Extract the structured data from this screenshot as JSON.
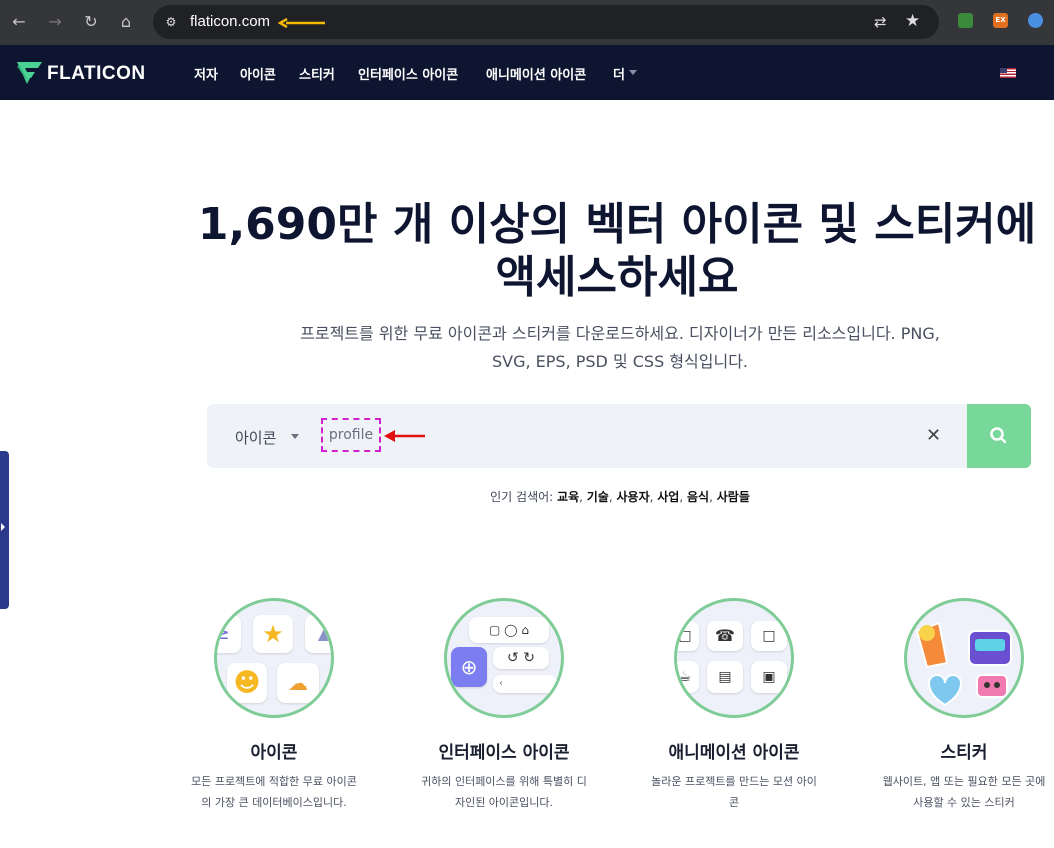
{
  "browser": {
    "url": "flaticon.com",
    "ext1": "",
    "ext2": "EX"
  },
  "header": {
    "logo": "FLATICON",
    "nav": [
      "저자",
      "아이콘",
      "스티커",
      "인터페이스 아이콘",
      "애니메이션 아이콘",
      "더"
    ]
  },
  "hero": {
    "title_line1": "1,690만 개 이상의 벡터 아이콘 및 스티커에",
    "title_line2": "액세스하세요",
    "subtitle_line1": "프로젝트를 위한 무료 아이콘과 스티커를 다운로드하세요. 디자이너가 만든 리소스입니다. PNG,",
    "subtitle_line2": "SVG, EPS, PSD 및 CSS 형식입니다."
  },
  "search": {
    "type": "아이콘",
    "query": "profile"
  },
  "popular": {
    "label": "인기 검색어:",
    "terms": [
      "교육",
      "기술",
      "사용자",
      "사업",
      "음식",
      "사람들"
    ]
  },
  "cards": [
    {
      "title": "아이콘",
      "desc_line1": "모든 프로젝트에 적합한 무료 아이콘",
      "desc_line2": "의 가장 큰 데이터베이스입니다."
    },
    {
      "title": "인터페이스 아이콘",
      "desc_line1": "귀하의 인터페이스를 위해 특별히 디",
      "desc_line2": "자인된 아이콘입니다."
    },
    {
      "title": "애니메이션 아이콘",
      "desc_line1": "놀라운 프로젝트를 만드는 모션 아이",
      "desc_line2": "콘"
    },
    {
      "title": "스티커",
      "desc_line1": "웹사이트, 앱 또는 필요한 모든 곳에",
      "desc_line2": "사용할 수 있는 스티커"
    }
  ],
  "colors": {
    "header_bg": "#0e1530",
    "search_button": "#78d89a",
    "annotation_yellow": "#f5b800",
    "annotation_red": "#e01010",
    "annotation_magenta": "#d020d0"
  }
}
